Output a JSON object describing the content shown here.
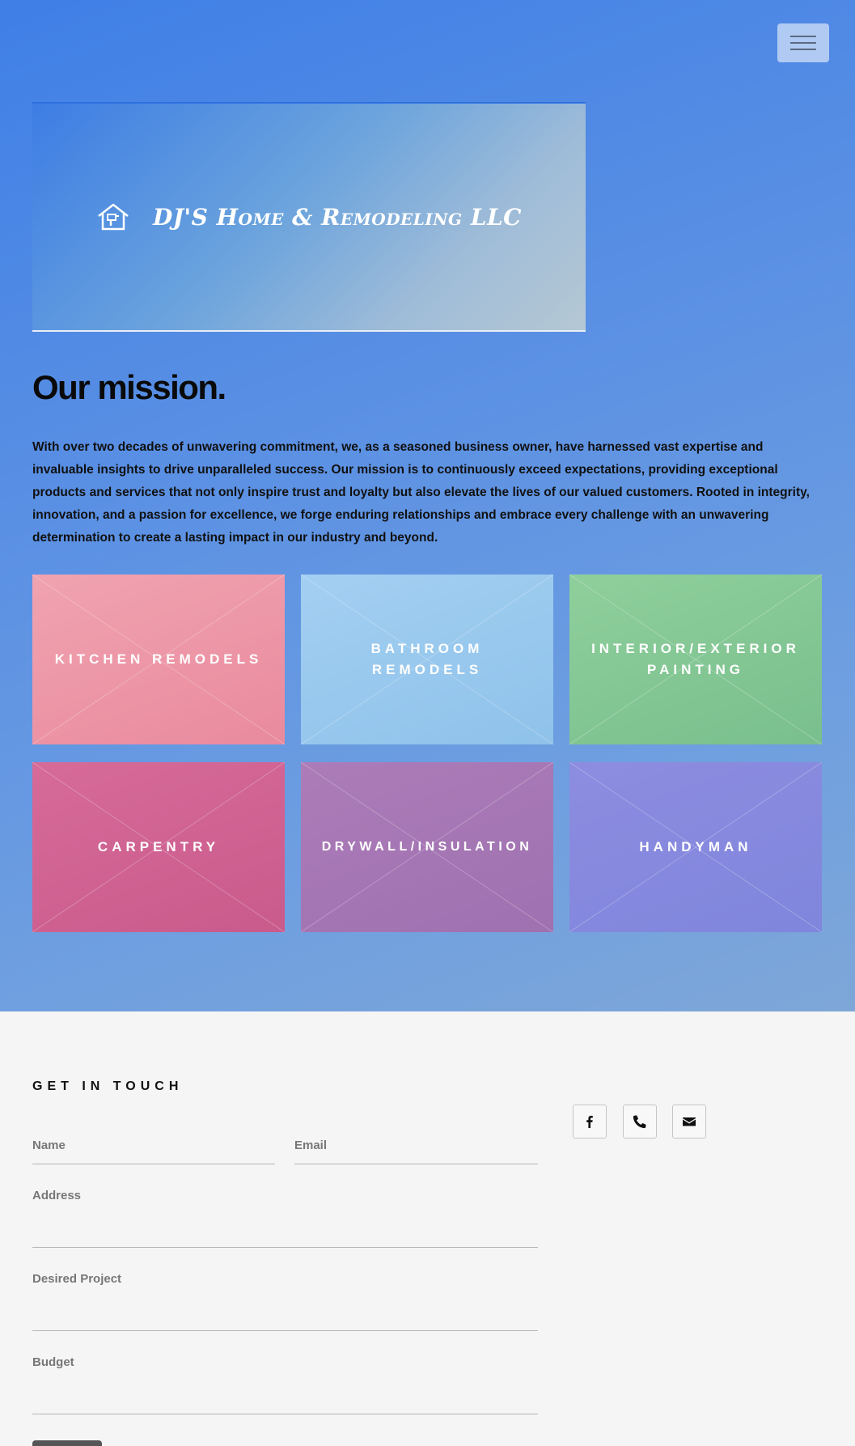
{
  "nav": {
    "menu_icon": "hamburger-menu-icon"
  },
  "banner": {
    "logo_icon": "house-tools-icon",
    "title": "DJ'S Home & Remodeling LLC"
  },
  "mission": {
    "heading": "Our mission.",
    "text": "With over two decades of unwavering commitment, we, as a seasoned business owner, have harnessed vast expertise and invaluable insights to drive unparalleled success. Our mission is to continuously exceed expectations, providing exceptional products and services that not only inspire trust and loyalty but also elevate the lives of our valued customers. Rooted in integrity, innovation, and a passion for excellence, we forge enduring relationships and embrace every challenge with an unwavering determination to create a lasting impact in our industry and beyond."
  },
  "services": [
    {
      "label": "KITCHEN REMODELS",
      "color": "#ee9bab"
    },
    {
      "label": "BATHROOM REMODELS",
      "color": "#9acaf0"
    },
    {
      "label": "INTERIOR/EXTERIOR PAINTING",
      "color": "#86c898"
    },
    {
      "label": "CARPENTRY",
      "color": "#d06494"
    },
    {
      "label": "DRYWALL/INSULATION",
      "color": "#a678b4"
    },
    {
      "label": "HANDYMAN",
      "color": "#8789de"
    }
  ],
  "contact": {
    "heading": "GET IN TOUCH",
    "fields": {
      "name": "Name",
      "email": "Email",
      "address": "Address",
      "project": "Desired Project",
      "budget": "Budget"
    }
  },
  "social": [
    {
      "icon": "facebook-icon"
    },
    {
      "icon": "phone-icon"
    },
    {
      "icon": "envelope-icon"
    }
  ],
  "colors": {
    "hero_gradient_start": "#3f7fe6",
    "hero_gradient_end": "#7ea7d8",
    "page_background": "#f5f5f5"
  }
}
